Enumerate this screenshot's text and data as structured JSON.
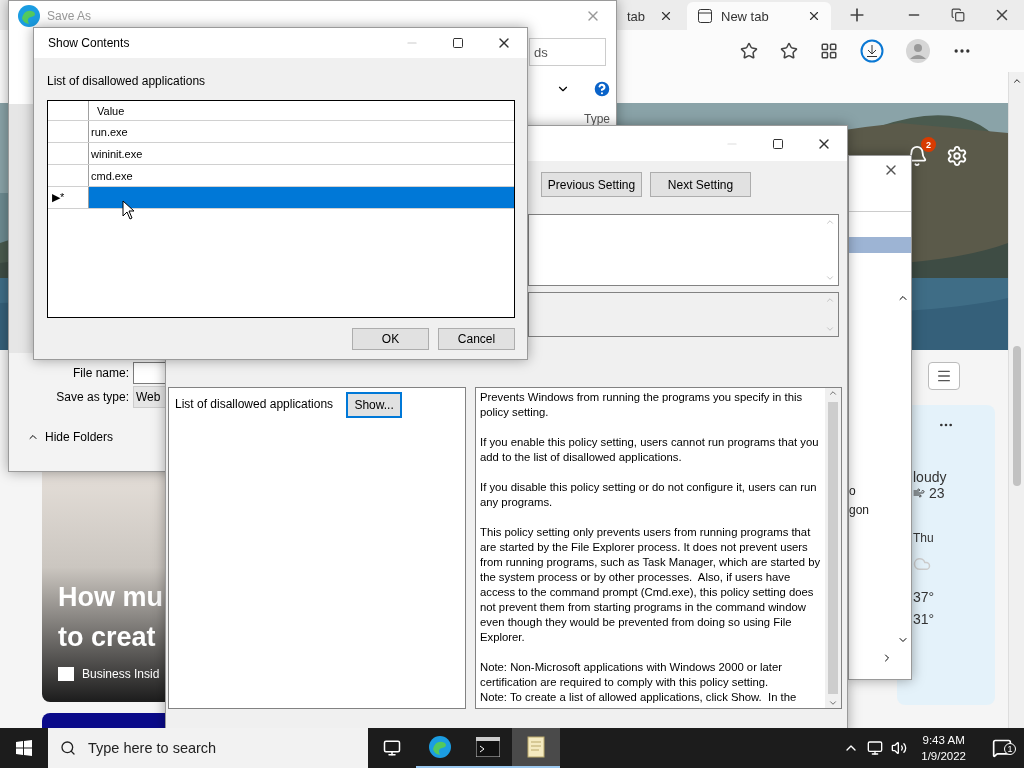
{
  "browser": {
    "tabs": [
      {
        "label": "tab",
        "selected": false
      },
      {
        "label": "New tab",
        "selected": true
      }
    ],
    "notification_badge": "2"
  },
  "news_card": {
    "headline": [
      "How mu",
      "to creat"
    ],
    "source": "Business Insid"
  },
  "weather_card": {
    "condition": "loudy",
    "wind": "23",
    "day": "Thu",
    "high": "37°",
    "low": "31°"
  },
  "side_window": {
    "texts": [
      "o",
      "gon"
    ]
  },
  "save_as": {
    "title": "Save As",
    "search_value": "ds",
    "column": "Type",
    "file_name_label": "File name:",
    "type_label": "Save as type:",
    "type_value": "Web",
    "hide_folders": "Hide Folders"
  },
  "policy_window": {
    "buttons": [
      "Previous Setting",
      "Next Setting"
    ],
    "option_label": "List of disallowed applications",
    "show_button": "Show...",
    "help": [
      "Prevents Windows from running the programs you specify in this policy setting.",
      "If you enable this policy setting, users cannot run programs that you add to the list of disallowed applications.",
      "If you disable this policy setting or do not configure it, users can run any programs.",
      "This policy setting only prevents users from running programs that are started by the File Explorer process. It does not prevent users from running programs, such as Task Manager, which are started by the system process or by other processes.  Also, if users have access to the command prompt (Cmd.exe), this policy setting does not prevent them from starting programs in the command window even though they would be prevented from doing so using File Explorer.",
      "Note: Non-Microsoft applications with Windows 2000 or later certification are required to comply with this policy setting.\nNote: To create a list of allowed applications, click Show.  In the"
    ]
  },
  "show_contents": {
    "title": "Show Contents",
    "label": "List of disallowed applications",
    "column": "Value",
    "rows": [
      {
        "value": "run.exe",
        "selected": false
      },
      {
        "value": "wininit.exe",
        "selected": false
      },
      {
        "value": "cmd.exe",
        "selected": false
      },
      {
        "marker": "▶*",
        "selected": true
      }
    ],
    "buttons": [
      "OK",
      "Cancel"
    ]
  },
  "taskbar": {
    "search_placeholder": "Type here to search",
    "apps": [
      {
        "kind": "edge",
        "focused": false
      },
      {
        "kind": "terminal",
        "focused": false
      },
      {
        "kind": "notepad",
        "focused": true
      }
    ],
    "time": "9:43 AM",
    "date": "1/9/2022",
    "notification_count": "1"
  }
}
